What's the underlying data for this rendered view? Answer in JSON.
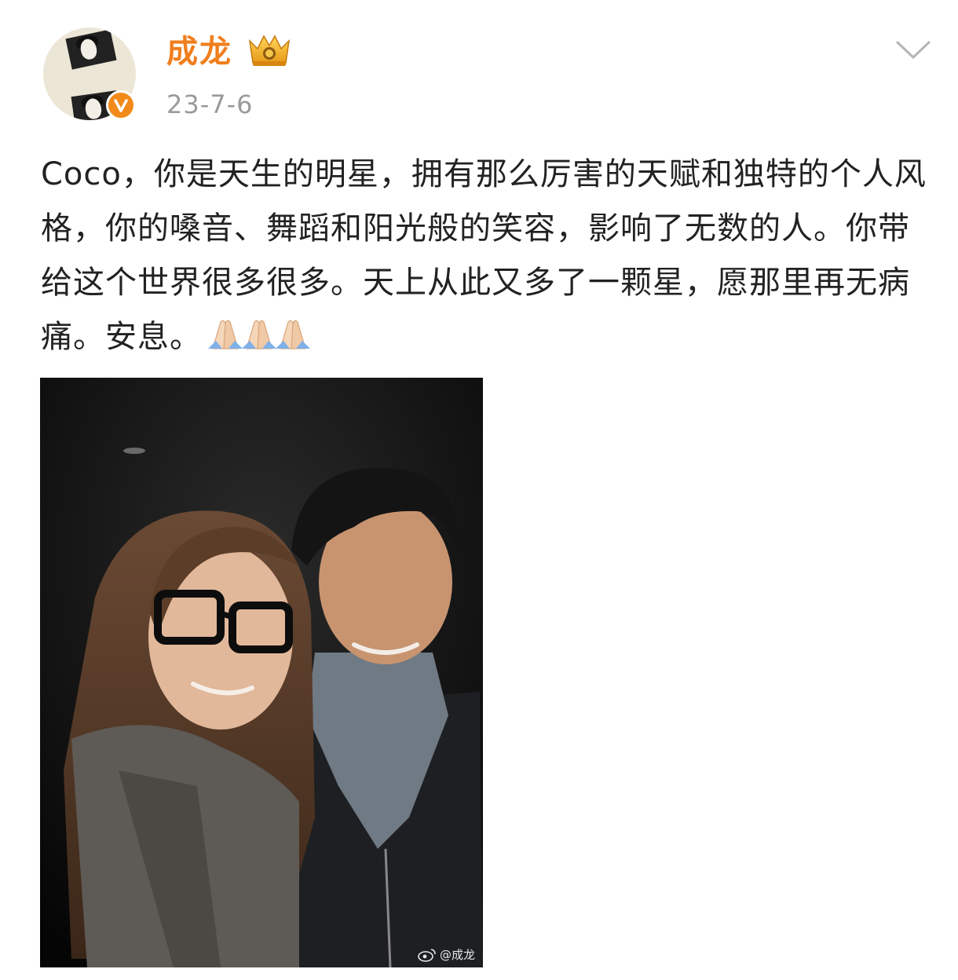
{
  "post": {
    "author": {
      "name": "成龙",
      "verified": true,
      "badge_color": "#f28a1a",
      "name_color": "#f07e1c"
    },
    "date": "23-7-6",
    "text": "Coco，你是天生的明星，拥有那么厉害的天赋和独特的个人风格，你的嗓音、舞蹈和阳光般的笑容，影响了无数的人。你带给这个世界很多很多。天上从此又多了一颗星，愿那里再无病痛。安息。",
    "emojis": [
      "folded-hands",
      "folded-hands",
      "folded-hands"
    ],
    "image": {
      "watermark": "@成龙"
    }
  }
}
